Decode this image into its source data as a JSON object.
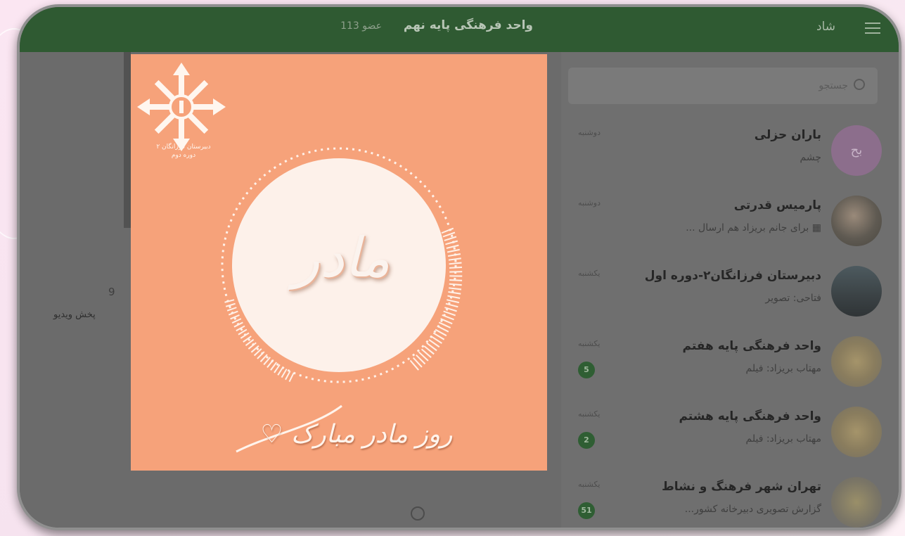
{
  "header": {
    "app_name": "شاد",
    "chat_title": "واحد فرهنگی پایه نهم",
    "members": "113 عضو"
  },
  "search": {
    "placeholder": "جستجو"
  },
  "chats": [
    {
      "name": "باران حزلی",
      "preview": "چشم",
      "day": "دوشنبه",
      "avatar_text": "بح",
      "badge": ""
    },
    {
      "name": "پارمیس قدرتی",
      "preview": "▦ برای جانم بریزاد هم ارسال ...",
      "day": "دوشنبه",
      "avatar_text": "",
      "badge": ""
    },
    {
      "name": "دبیرستان فرزانگان۲-دوره اول",
      "preview": "فتاحی: تصویر",
      "day": "یکشنبه",
      "avatar_text": "",
      "badge": ""
    },
    {
      "name": "واحد فرهنگی پایه هفتم",
      "preview": "مهتاب بریزاد: فیلم",
      "day": "یکشنبه",
      "avatar_text": "",
      "badge": "5"
    },
    {
      "name": "واحد فرهنگی پایه هشتم",
      "preview": "مهتاب بریزاد: فیلم",
      "day": "یکشنبه",
      "avatar_text": "",
      "badge": "2"
    },
    {
      "name": "تهران شهر فرهنگ و نشاط",
      "preview": "گزارش تصویری دبیرخانه کشور...",
      "day": "یکشنبه",
      "avatar_text": "",
      "badge": "51"
    }
  ],
  "chat_area": {
    "number": "9",
    "video_label": "پخش ویدیو"
  },
  "poster": {
    "school_name": "دبیرستان فرزانگان ۲",
    "school_sub": "دوره دوم",
    "center_word": "مادر",
    "greeting": "روز مادر مبارک ♡",
    "background_color": "#f6a27a"
  }
}
